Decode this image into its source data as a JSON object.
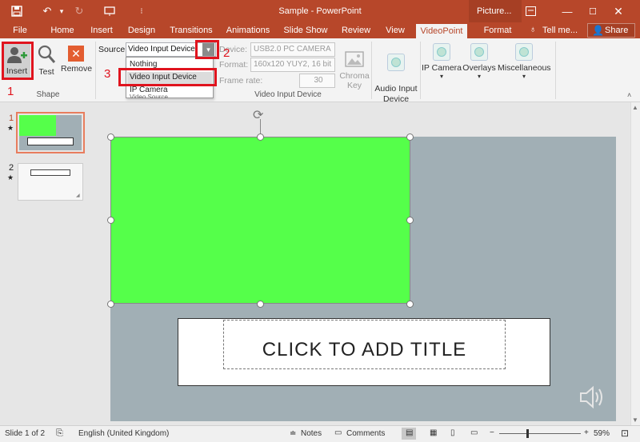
{
  "window": {
    "title": "Sample - PowerPoint",
    "context_tab": "Picture...",
    "share": "Share",
    "tell_me": "Tell me..."
  },
  "tabs": [
    {
      "label": "File"
    },
    {
      "label": "Home"
    },
    {
      "label": "Insert"
    },
    {
      "label": "Design"
    },
    {
      "label": "Transitions"
    },
    {
      "label": "Animations"
    },
    {
      "label": "Slide Show"
    },
    {
      "label": "Review"
    },
    {
      "label": "View"
    },
    {
      "label": "VideoPoint"
    },
    {
      "label": "Format"
    }
  ],
  "ribbon": {
    "shape_group": {
      "label": "Shape",
      "insert": "Insert",
      "test": "Test",
      "remove": "Remove"
    },
    "source_label": "Source",
    "source_value": "Video Input Device",
    "dropdown_options": [
      "Nothing",
      "Video Input Device",
      "IP Camera"
    ],
    "device_label": "Device:",
    "device_value": "USB2.0 PC CAMERA",
    "format_label": "Format:",
    "format_value": "160x120 YUY2, 16 bit",
    "framerate_label": "Frame rate:",
    "framerate_value": "30",
    "chroma_key": "Chroma\nKey",
    "group_label": "Video Input Device",
    "audio_input": "Audio Input\nDevice",
    "ip_camera": "IP Camera",
    "overlays": "Overlays",
    "misc": "Miscellaneous",
    "hidden_group_label": "Video Source"
  },
  "annotations": [
    "1",
    "2",
    "3"
  ],
  "thumbnails": [
    {
      "number": "1",
      "star": "★"
    },
    {
      "number": "2",
      "star": "★"
    }
  ],
  "slide": {
    "title_placeholder": "CLICK TO ADD TITLE"
  },
  "status": {
    "slide_info": "Slide 1 of 2",
    "language": "English (United Kingdom)",
    "notes": "Notes",
    "comments": "Comments",
    "zoom": "59%"
  },
  "colors": {
    "accent": "#b7472a",
    "green_box": "#55ff4a",
    "slide_bg": "#a1afb5",
    "annotation_red": "#e0141e"
  }
}
